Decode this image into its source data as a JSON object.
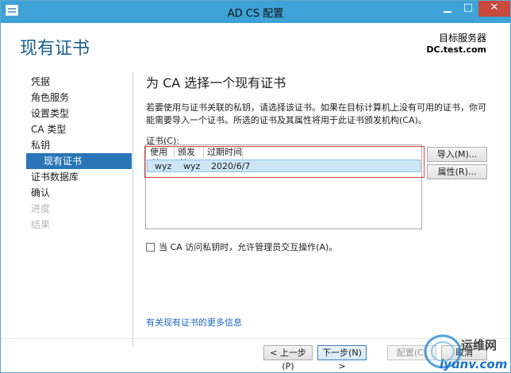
{
  "window": {
    "title": "AD CS 配置",
    "min_label": "▁",
    "max_label": "□",
    "close_label": "✕"
  },
  "header": {
    "page_title": "现有证书",
    "destination_label": "目标服务器",
    "destination_server": "DC.test.com"
  },
  "nav": {
    "items": [
      {
        "label": "凭据",
        "state": "normal"
      },
      {
        "label": "角色服务",
        "state": "normal"
      },
      {
        "label": "设置类型",
        "state": "normal"
      },
      {
        "label": "CA 类型",
        "state": "normal"
      },
      {
        "label": "私钥",
        "state": "normal"
      },
      {
        "label": "现有证书",
        "state": "active"
      },
      {
        "label": "证书数据库",
        "state": "normal"
      },
      {
        "label": "确认",
        "state": "normal"
      },
      {
        "label": "进度",
        "state": "disabled"
      },
      {
        "label": "结果",
        "state": "disabled"
      }
    ]
  },
  "main": {
    "section_title": "为 CA 选择一个现有证书",
    "description": "若要使用与证书关联的私钥，请选择该证书。如果在目标计算机上没有可用的证书，你可能需要导入一个证书。所选的证书及其属性将用于此证书颁发机构(CA)。",
    "cert_label": "证书(C):",
    "columns": [
      "使用者",
      "颁发者",
      "过期时间"
    ],
    "rows": [
      {
        "subject": "wyz",
        "issuer": "wyz",
        "expires": "2020/6/7",
        "selected": true
      }
    ],
    "import_button": "导入(M)...",
    "properties_button": "属性(R)...",
    "checkbox_label": "当 CA 访问私钥时，允许管理员交互操作(A)。",
    "checkbox_checked": false,
    "more_info_link": "有关现有证书的更多信息"
  },
  "footer": {
    "back": "< 上一步(P)",
    "next": "下一步(N) >",
    "configure": "配置(C)",
    "cancel": "取消"
  },
  "watermark": {
    "line1": "运维网",
    "line2": "iyunv.com"
  },
  "colors": {
    "titlebar": "#3ea2d6",
    "accent": "#2a76b8",
    "page_title": "#1a5f8c",
    "highlight": "#d4453b",
    "link": "#1b67c2"
  }
}
